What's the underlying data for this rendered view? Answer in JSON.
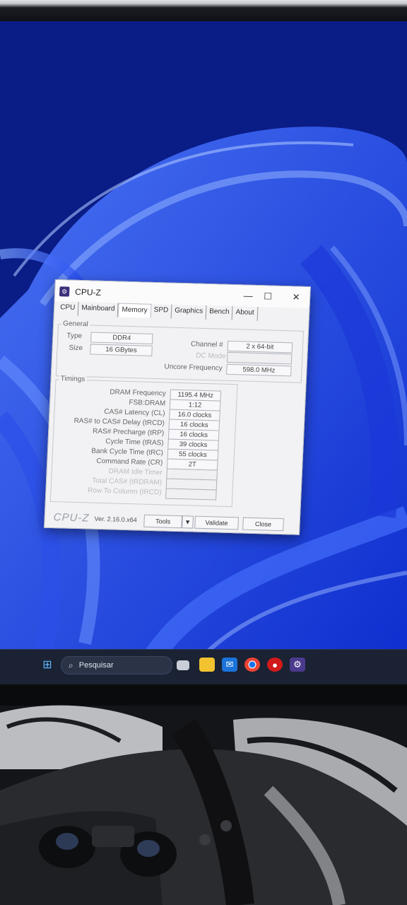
{
  "window": {
    "title": "CPU-Z",
    "controls": {
      "minimize": "—",
      "maximize": "☐",
      "close": "✕"
    }
  },
  "tabs": [
    "CPU",
    "Mainboard",
    "Memory",
    "SPD",
    "Graphics",
    "Bench",
    "About"
  ],
  "active_tab": "Memory",
  "general": {
    "label": "General",
    "type_label": "Type",
    "type_value": "DDR4",
    "size_label": "Size",
    "size_value": "16 GBytes",
    "channel_label": "Channel #",
    "channel_value": "2 x 64-bit",
    "dc_mode_label": "DC Mode",
    "dc_mode_value": "",
    "uncore_label": "Uncore Frequency",
    "uncore_value": "598.0 MHz"
  },
  "timings": {
    "label": "Timings",
    "rows": [
      {
        "label": "DRAM Frequency",
        "value": "1195.4 MHz",
        "dim": false
      },
      {
        "label": "FSB:DRAM",
        "value": "1:12",
        "dim": false
      },
      {
        "label": "CAS# Latency (CL)",
        "value": "16.0 clocks",
        "dim": false
      },
      {
        "label": "RAS# to CAS# Delay (tRCD)",
        "value": "16 clocks",
        "dim": false
      },
      {
        "label": "RAS# Precharge (tRP)",
        "value": "16 clocks",
        "dim": false
      },
      {
        "label": "Cycle Time (tRAS)",
        "value": "39 clocks",
        "dim": false
      },
      {
        "label": "Bank Cycle Time (tRC)",
        "value": "55 clocks",
        "dim": false
      },
      {
        "label": "Command Rate (CR)",
        "value": "2T",
        "dim": false
      },
      {
        "label": "DRAM Idle Timer",
        "value": "",
        "dim": true
      },
      {
        "label": "Total CAS# (tRDRAM)",
        "value": "",
        "dim": true
      },
      {
        "label": "Row To Column (tRCD)",
        "value": "",
        "dim": true
      }
    ]
  },
  "footer": {
    "logo": "CPU-Z",
    "version": "Ver. 2.16.0.x64",
    "tools_label": "Tools",
    "tools_arrow": "▼",
    "validate_label": "Validate",
    "close_label": "Close"
  },
  "taskbar": {
    "search_icon": "magnifier-icon",
    "search_placeholder": "Pesquisar",
    "icons": [
      "windows-start-icon",
      "task-view-icon",
      "file-explorer-icon",
      "outlook-icon",
      "chrome-icon",
      "red-app-icon",
      "cpuz-taskbar-icon"
    ]
  }
}
